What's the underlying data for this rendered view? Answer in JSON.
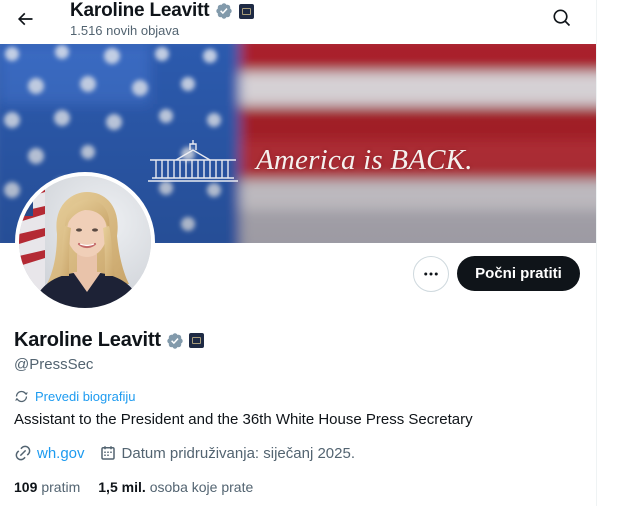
{
  "header": {
    "name": "Karoline Leavitt",
    "posts_count": "1.516 novih objava",
    "back_icon": "arrow-left-icon",
    "search_icon": "search-icon"
  },
  "banner": {
    "text": "America is BACK."
  },
  "actions": {
    "more_icon": "more-dots-icon",
    "follow_label": "Počni pratiti"
  },
  "profile": {
    "display_name": "Karoline Leavitt",
    "handle": "@PressSec",
    "translate_label": "Prevedi biografiju",
    "bio": "Assistant to the President and the 36th White House Press Secretary",
    "website": "wh.gov",
    "joined": "Datum pridruživanja: siječanj 2025."
  },
  "stats": {
    "following_count": "109",
    "following_label": "pratim",
    "followers_count": "1,5 mil.",
    "followers_label": "osoba koje prate"
  },
  "colors": {
    "accent": "#1d9bf0",
    "text_primary": "#0f1419",
    "text_secondary": "#536471",
    "button_dark": "#0f1419",
    "verified_badge": "#829aab"
  }
}
